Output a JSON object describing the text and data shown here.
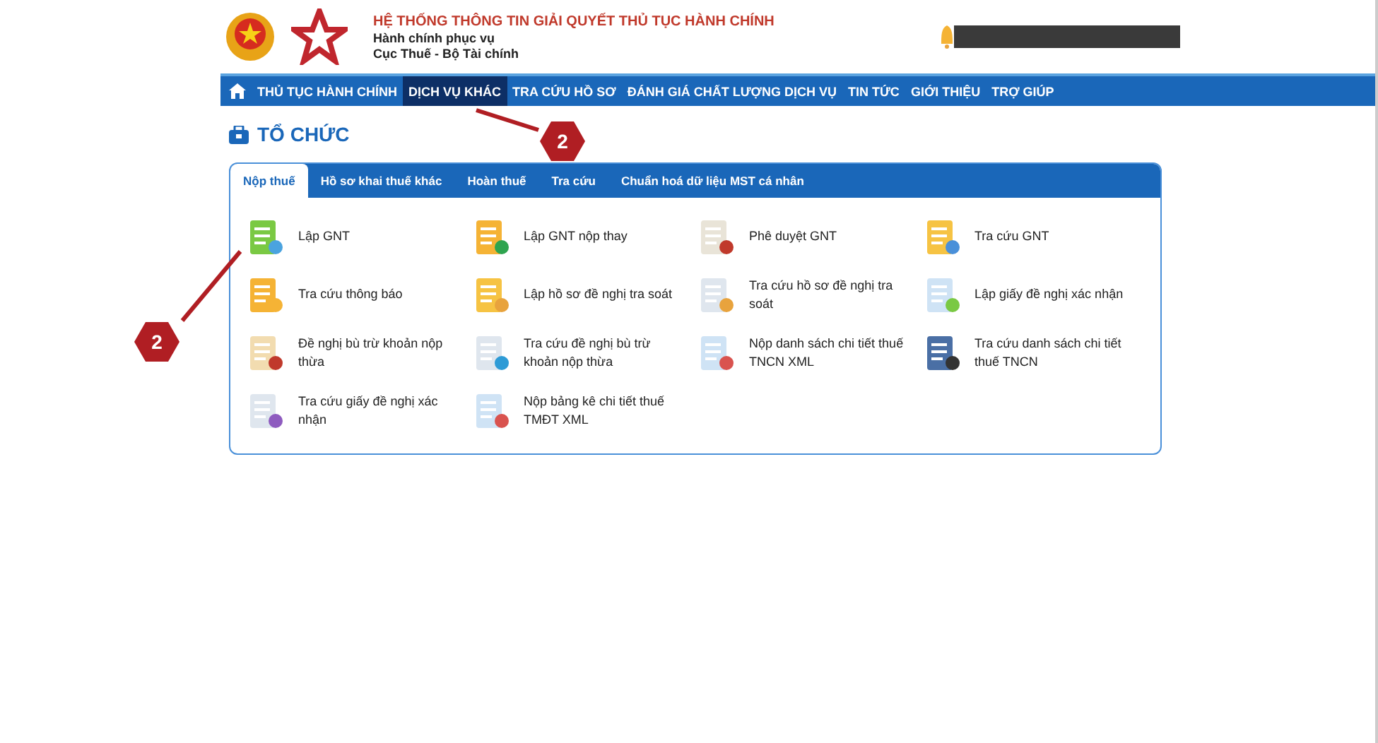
{
  "header": {
    "title": "HỆ THỐNG THÔNG TIN GIẢI QUYẾT THỦ TỤC HÀNH CHÍNH",
    "subtitle_1": "Hành chính phục vụ",
    "subtitle_2": "Cục Thuế - Bộ Tài chính"
  },
  "nav": [
    {
      "label": "THỦ TỤC HÀNH CHÍNH",
      "selected": false
    },
    {
      "label": "DỊCH VỤ KHÁC",
      "selected": true
    },
    {
      "label": "TRA CỨU HỒ SƠ",
      "selected": false
    },
    {
      "label": "ĐÁNH GIÁ CHẤT LƯỢNG DỊCH VỤ",
      "selected": false
    },
    {
      "label": "TIN TỨC",
      "selected": false
    },
    {
      "label": "GIỚI THIỆU",
      "selected": false
    },
    {
      "label": "TRỢ GIÚP",
      "selected": false
    }
  ],
  "section_title": "TỔ CHỨC",
  "tabs": [
    {
      "label": "Nộp thuế",
      "selected": true
    },
    {
      "label": "Hồ sơ khai thuế khác",
      "selected": false
    },
    {
      "label": "Hoàn thuế",
      "selected": false
    },
    {
      "label": "Tra cứu",
      "selected": false
    },
    {
      "label": "Chuẩn hoá dữ liệu MST cá nhân",
      "selected": false
    }
  ],
  "services": [
    {
      "label": "Lập GNT"
    },
    {
      "label": "Lập GNT nộp thay"
    },
    {
      "label": "Phê duyệt GNT"
    },
    {
      "label": "Tra cứu GNT"
    },
    {
      "label": "Tra cứu thông báo"
    },
    {
      "label": "Lập hồ sơ đề nghị tra soát"
    },
    {
      "label": "Tra cứu hồ sơ đề nghị tra soát"
    },
    {
      "label": "Lập giấy đề nghị xác nhận"
    },
    {
      "label": "Đề nghị bù trừ khoản nộp thừa"
    },
    {
      "label": "Tra cứu đề nghị bù trừ khoản nộp thừa"
    },
    {
      "label": "Nộp danh sách chi tiết thuế TNCN XML"
    },
    {
      "label": "Tra cứu danh sách chi tiết thuế TNCN"
    },
    {
      "label": "Tra cứu giấy đề nghị xác nhận"
    },
    {
      "label": "Nộp bảng kê chi tiết thuế TMĐT XML"
    }
  ],
  "annotations": [
    {
      "label": "2"
    },
    {
      "label": "2"
    }
  ]
}
